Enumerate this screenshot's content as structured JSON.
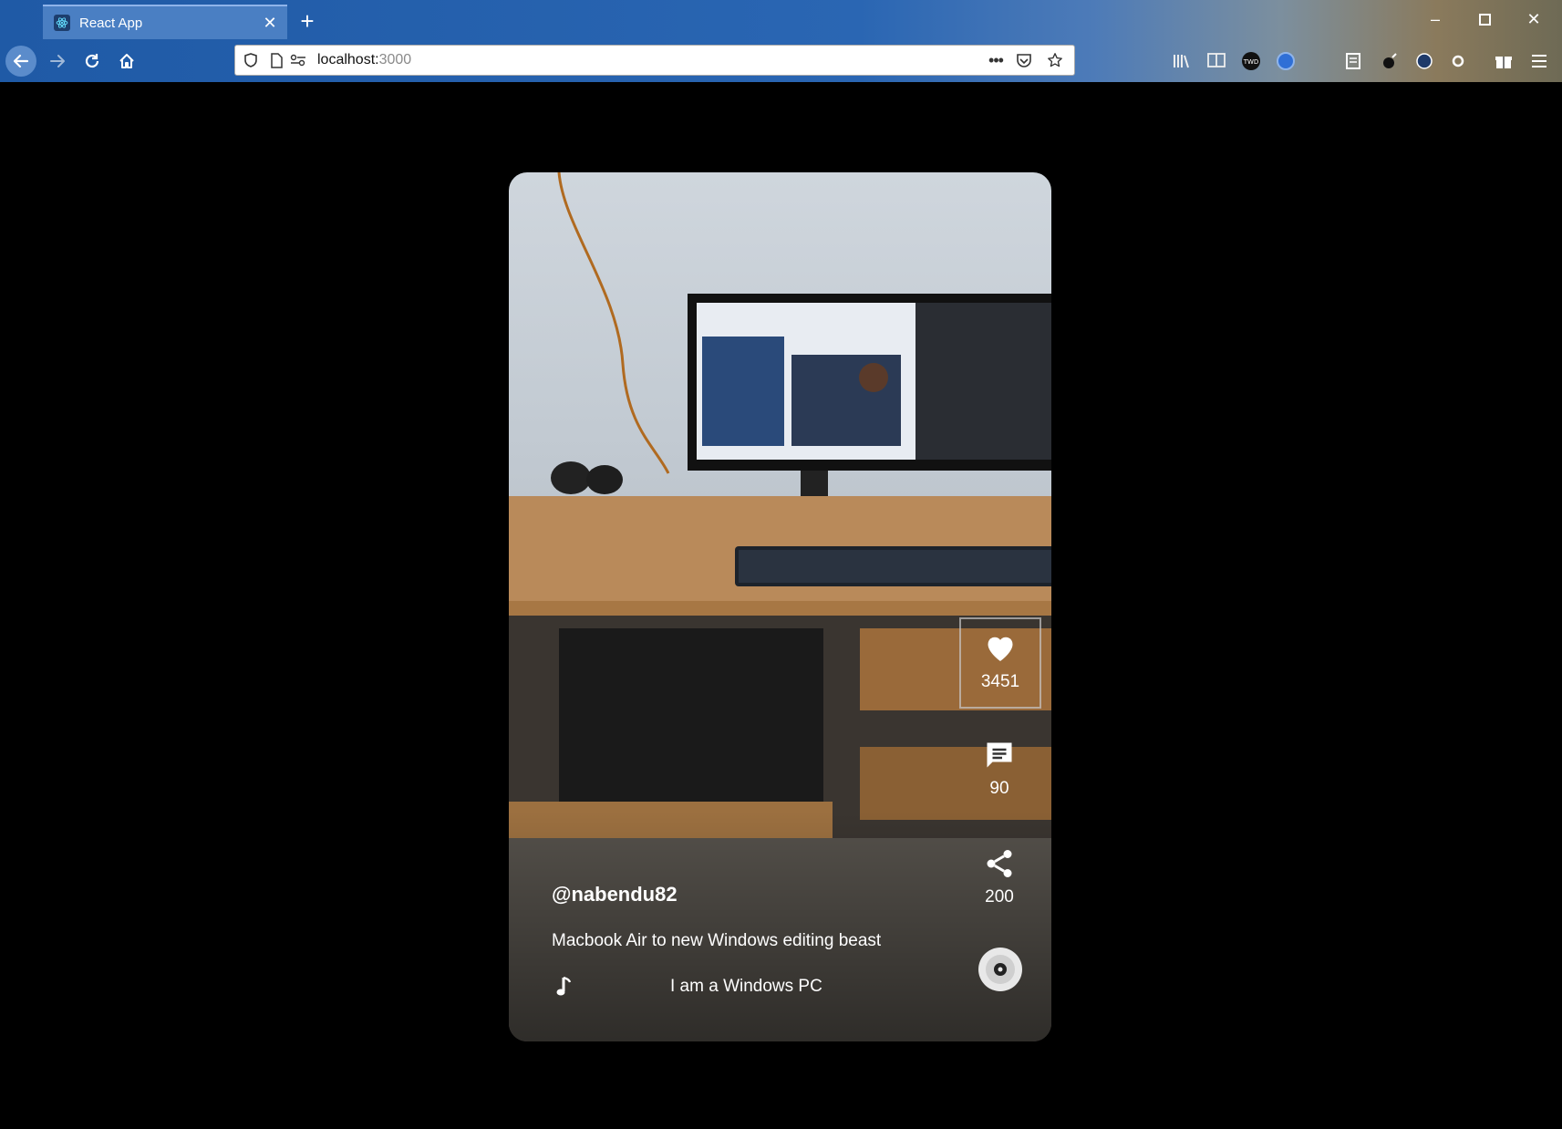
{
  "browser": {
    "tab_title": "React App",
    "url_host": "localhost:",
    "url_port": "3000"
  },
  "video": {
    "username": "@nabendu82",
    "description": "Macbook Air to new Windows editing beast",
    "song": "I am a Windows PC",
    "likes": "3451",
    "comments": "90",
    "shares": "200"
  }
}
